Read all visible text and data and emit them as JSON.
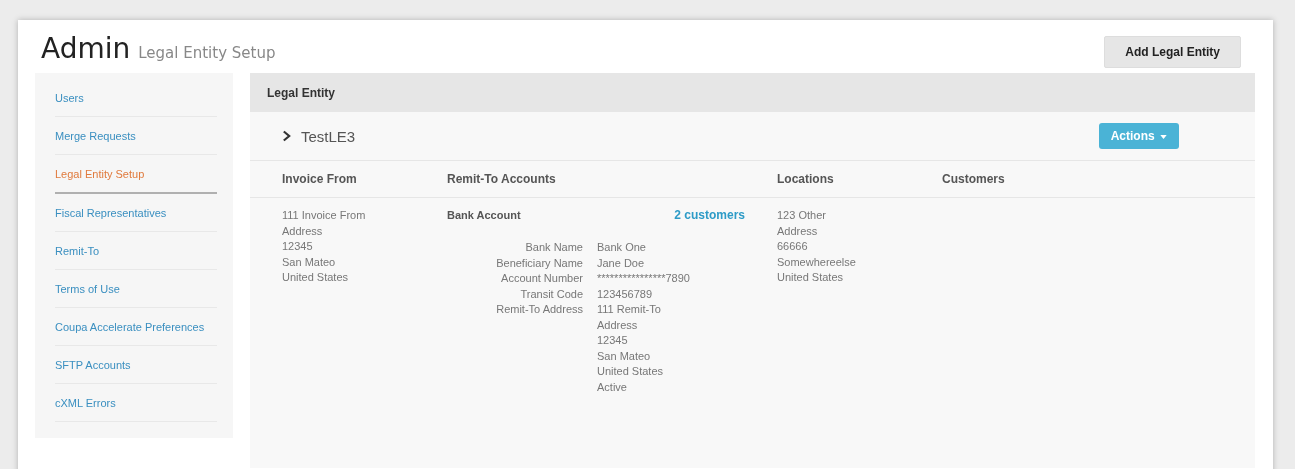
{
  "header": {
    "title": "Admin",
    "subtitle": "Legal Entity Setup",
    "button": "Add Legal Entity"
  },
  "sidebar": {
    "items": [
      {
        "label": "Users",
        "selected": false
      },
      {
        "label": "Merge Requests",
        "selected": false
      },
      {
        "label": "Legal Entity Setup",
        "selected": true
      },
      {
        "label": "Fiscal Representatives",
        "selected": false
      },
      {
        "label": "Remit-To",
        "selected": false
      },
      {
        "label": "Terms of Use",
        "selected": false
      },
      {
        "label": "Coupa Accelerate Preferences",
        "selected": false
      },
      {
        "label": "SFTP Accounts",
        "selected": false
      },
      {
        "label": "cXML Errors",
        "selected": false
      }
    ]
  },
  "panel": {
    "title": "Legal Entity",
    "entity": {
      "name": "TestLE3",
      "expanded": false,
      "actions": "Actions"
    },
    "columns": [
      "Invoice From",
      "Remit-To Accounts",
      "Locations",
      "Customers"
    ],
    "invoice_from": [
      "111 Invoice From",
      "Address",
      "12345",
      "San Mateo",
      "United States"
    ],
    "remit_to": {
      "title": "Bank Account",
      "customers_link": "2 customers",
      "fields": [
        {
          "label": "Bank Name",
          "value": [
            "Bank One"
          ]
        },
        {
          "label": "Beneficiary Name",
          "value": [
            "Jane Doe"
          ]
        },
        {
          "label": "Account Number",
          "value": [
            "****************7890"
          ]
        },
        {
          "label": "Transit Code",
          "value": [
            "123456789"
          ]
        },
        {
          "label": "Remit-To Address",
          "value": [
            "111 Remit-To",
            "Address",
            "12345",
            "San Mateo",
            "United States",
            "Active"
          ]
        }
      ]
    },
    "locations": [
      "123 Other",
      "Address",
      "66666",
      "Somewhereelse",
      "United States"
    ]
  }
}
